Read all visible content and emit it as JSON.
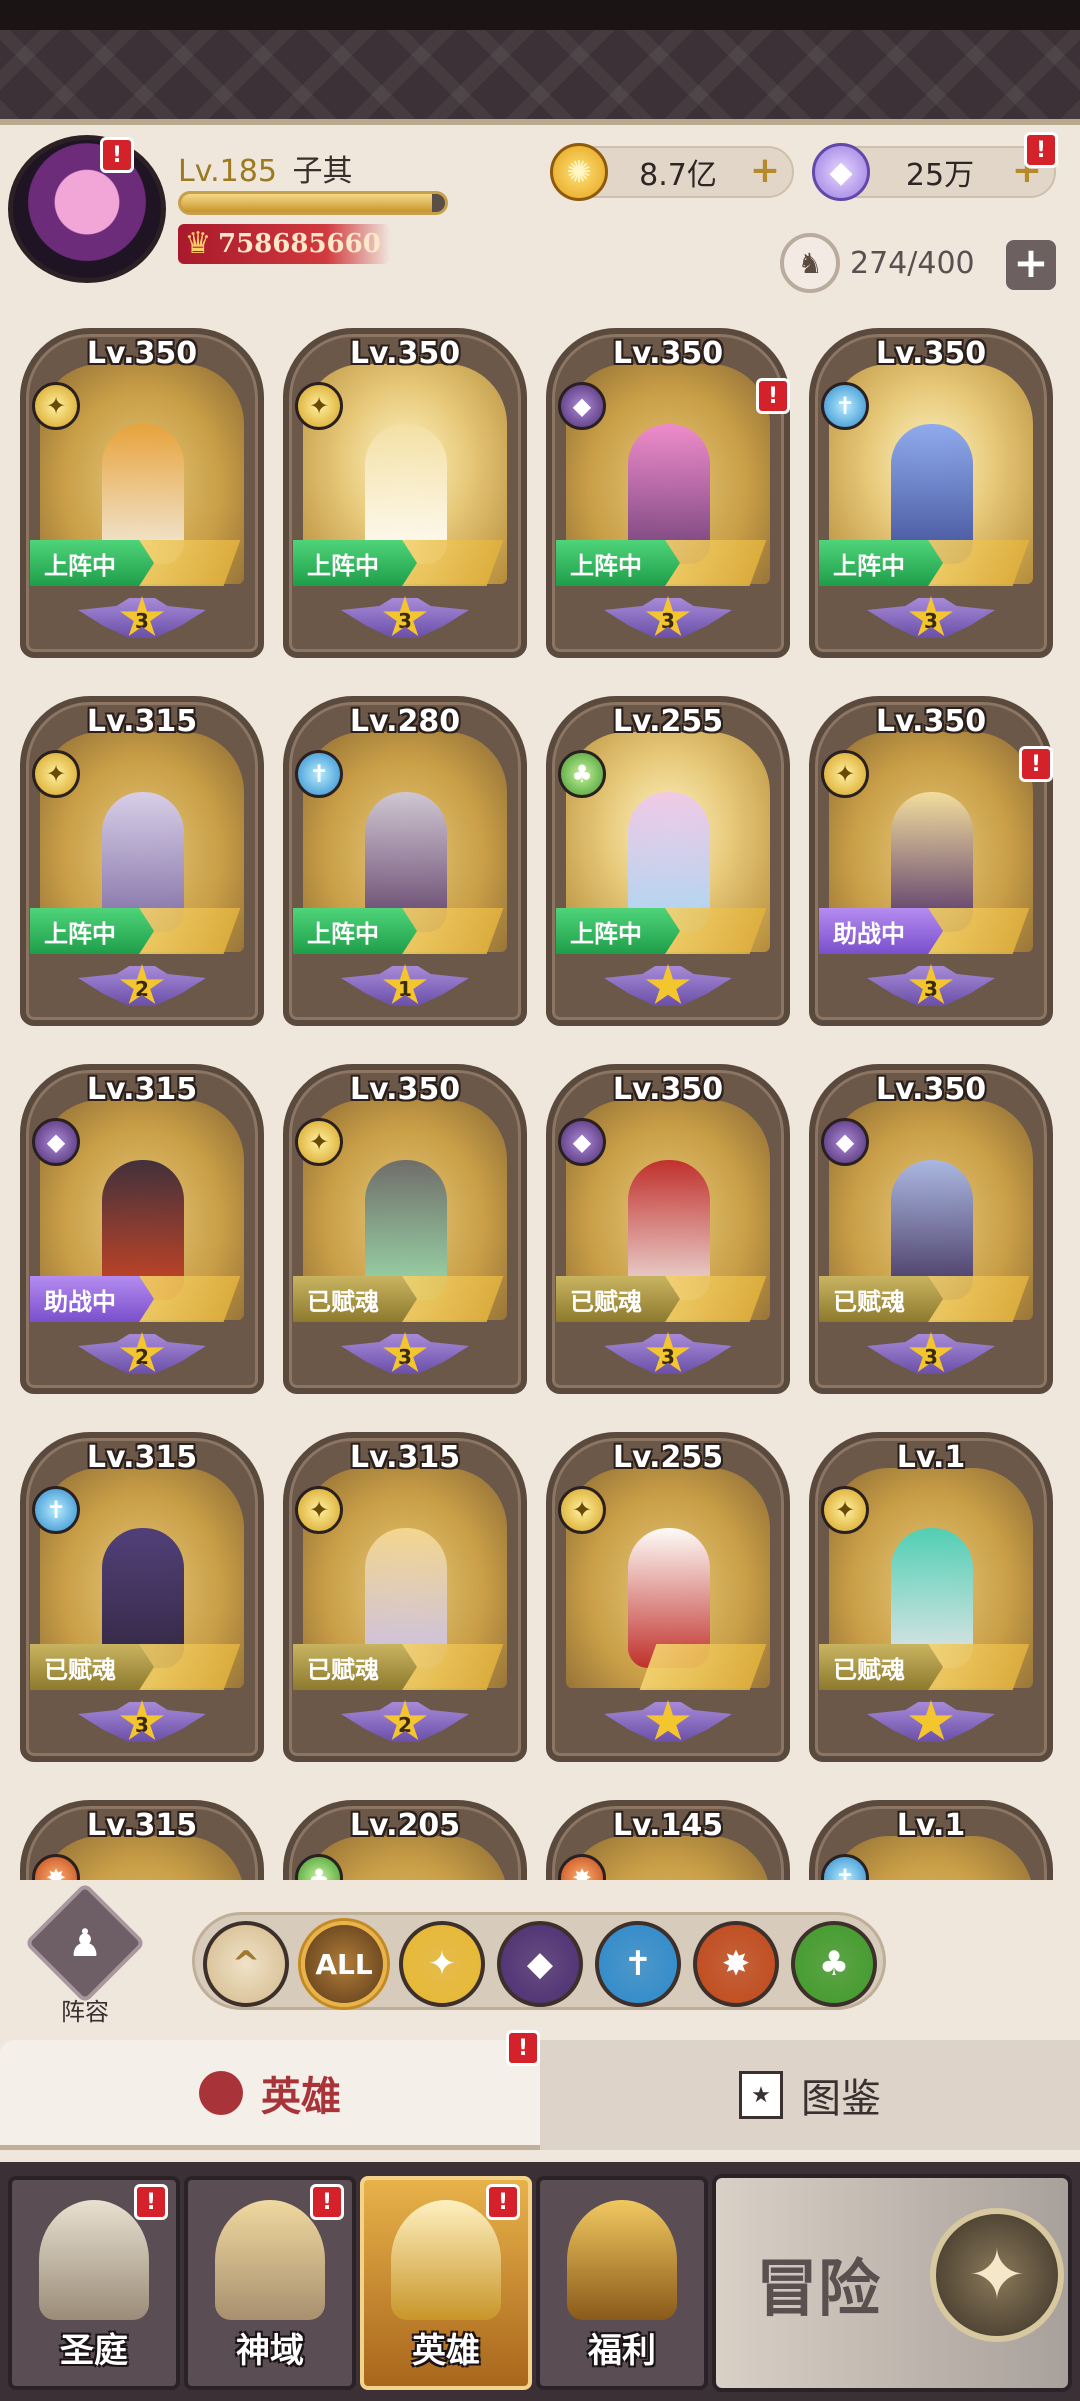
{
  "player": {
    "level_label": "Lv.185",
    "name": "子其",
    "exp_fraction": 0.95,
    "power": "758685660",
    "avatar_has_alert": true
  },
  "currencies": {
    "gold": {
      "icon": "gold-coin-icon",
      "value": "8.7亿"
    },
    "gems": {
      "icon": "diamond-icon",
      "value": "25万",
      "has_alert": true
    }
  },
  "hero_slots": {
    "value": "274/400",
    "icon": "hero-slot-icon"
  },
  "alert_mark": "!",
  "heroes": [
    {
      "level": "Lv.350",
      "faction": "light",
      "status": "上阵中",
      "stars": "3",
      "alert": false,
      "colors": [
        "#e8a23a",
        "#f3f0e8"
      ]
    },
    {
      "level": "Lv.350",
      "faction": "light",
      "status": "上阵中",
      "stars": "3",
      "alert": false,
      "colors": [
        "#f4e0a4",
        "#ffffff"
      ]
    },
    {
      "level": "Lv.350",
      "faction": "dark",
      "status": "上阵中",
      "stars": "3",
      "alert": true,
      "colors": [
        "#f08ad0",
        "#6a3a7a"
      ]
    },
    {
      "level": "Lv.350",
      "faction": "water",
      "status": "上阵中",
      "stars": "3",
      "alert": false,
      "colors": [
        "#8aa8f0",
        "#3a4a9a"
      ]
    },
    {
      "level": "Lv.315",
      "faction": "light",
      "status": "上阵中",
      "stars": "2",
      "alert": false,
      "colors": [
        "#d8d0ee",
        "#7a6aa8"
      ]
    },
    {
      "level": "Lv.280",
      "faction": "water",
      "status": "上阵中",
      "stars": "1",
      "alert": false,
      "colors": [
        "#d0c8d8",
        "#5a3a6a"
      ]
    },
    {
      "level": "Lv.255",
      "faction": "wood",
      "status": "上阵中",
      "stars": "",
      "alert": false,
      "colors": [
        "#f0c8e8",
        "#a8d8f8"
      ]
    },
    {
      "level": "Lv.350",
      "faction": "light",
      "status": "助战中",
      "stars": "3",
      "alert": true,
      "colors": [
        "#f4e0a0",
        "#4a2a6a"
      ]
    },
    {
      "level": "Lv.315",
      "faction": "dark",
      "status": "助战中",
      "stars": "2",
      "alert": false,
      "colors": [
        "#3a2a3a",
        "#d04020"
      ]
    },
    {
      "level": "Lv.350",
      "faction": "light",
      "status": "已赋魂",
      "stars": "3",
      "alert": false,
      "colors": [
        "#6a6a6a",
        "#9ae0b0"
      ]
    },
    {
      "level": "Lv.350",
      "faction": "dark",
      "status": "已赋魂",
      "stars": "3",
      "alert": false,
      "colors": [
        "#c02a2a",
        "#f0e8e8"
      ]
    },
    {
      "level": "Lv.350",
      "faction": "dark",
      "status": "已赋魂",
      "stars": "3",
      "alert": false,
      "colors": [
        "#a8b8e8",
        "#3a2a5a"
      ]
    },
    {
      "level": "Lv.315",
      "faction": "water",
      "status": "已赋魂",
      "stars": "3",
      "alert": false,
      "colors": [
        "#4a3a7a",
        "#2a2040"
      ]
    },
    {
      "level": "Lv.315",
      "faction": "light",
      "status": "已赋魂",
      "stars": "2",
      "alert": false,
      "colors": [
        "#f4d890",
        "#c8c0f0"
      ]
    },
    {
      "level": "Lv.255",
      "faction": "light",
      "status": "",
      "stars": "",
      "alert": false,
      "colors": [
        "#ffffff",
        "#c02a2a"
      ]
    },
    {
      "level": "Lv.1",
      "faction": "light",
      "status": "已赋魂",
      "stars": "",
      "alert": false,
      "colors": [
        "#4ad0b8",
        "#e8e8f0"
      ]
    },
    {
      "level": "Lv.315",
      "faction": "fire",
      "status": "",
      "stars": "",
      "alert": false,
      "colors": [
        "#8a7a6a",
        "#6a5a4a"
      ]
    },
    {
      "level": "Lv.205",
      "faction": "wood",
      "status": "",
      "stars": "",
      "alert": false,
      "colors": [
        "#e8d8c8",
        "#6a8a4a"
      ]
    },
    {
      "level": "Lv.145",
      "faction": "fire",
      "status": "",
      "stars": "",
      "alert": false,
      "colors": [
        "#c8a060",
        "#a04030"
      ]
    },
    {
      "level": "Lv.1",
      "faction": "water",
      "status": "",
      "stars": "",
      "alert": false,
      "colors": [
        "#8a7a6a",
        "#6a5a4a"
      ]
    }
  ],
  "lineup": {
    "label": "阵容",
    "icon": "chess-piece-icon"
  },
  "filters": [
    {
      "id": "collapse",
      "icon": "chevron-up-icon",
      "text": "^"
    },
    {
      "id": "all",
      "icon": "all-filter-icon",
      "text": "ALL",
      "active": true
    },
    {
      "id": "light",
      "icon": "light-faction-icon",
      "text": "✦",
      "color": "#e8b830"
    },
    {
      "id": "dark",
      "icon": "dark-faction-icon",
      "text": "◆",
      "color": "#4a2d72"
    },
    {
      "id": "water",
      "icon": "water-faction-icon",
      "text": "✝",
      "color": "#2c8acc"
    },
    {
      "id": "fire",
      "icon": "fire-faction-icon",
      "text": "✸",
      "color": "#c0481a"
    },
    {
      "id": "wood",
      "icon": "wood-faction-icon",
      "text": "♣",
      "color": "#3f9a2a"
    }
  ],
  "tabs": {
    "heroes": "英雄",
    "codex": "图鉴",
    "heroes_alert": true
  },
  "bottom_nav": [
    {
      "label": "圣庭",
      "icon": "sanctum-icon",
      "alert": true,
      "active": false
    },
    {
      "label": "神域",
      "icon": "divine-realm-icon",
      "alert": true,
      "active": false
    },
    {
      "label": "英雄",
      "icon": "hero-helmet-icon",
      "alert": true,
      "active": true
    },
    {
      "label": "福利",
      "icon": "treasure-chest-icon",
      "alert": false,
      "active": false
    }
  ],
  "adventure": {
    "label": "冒险",
    "icon": "compass-icon"
  }
}
